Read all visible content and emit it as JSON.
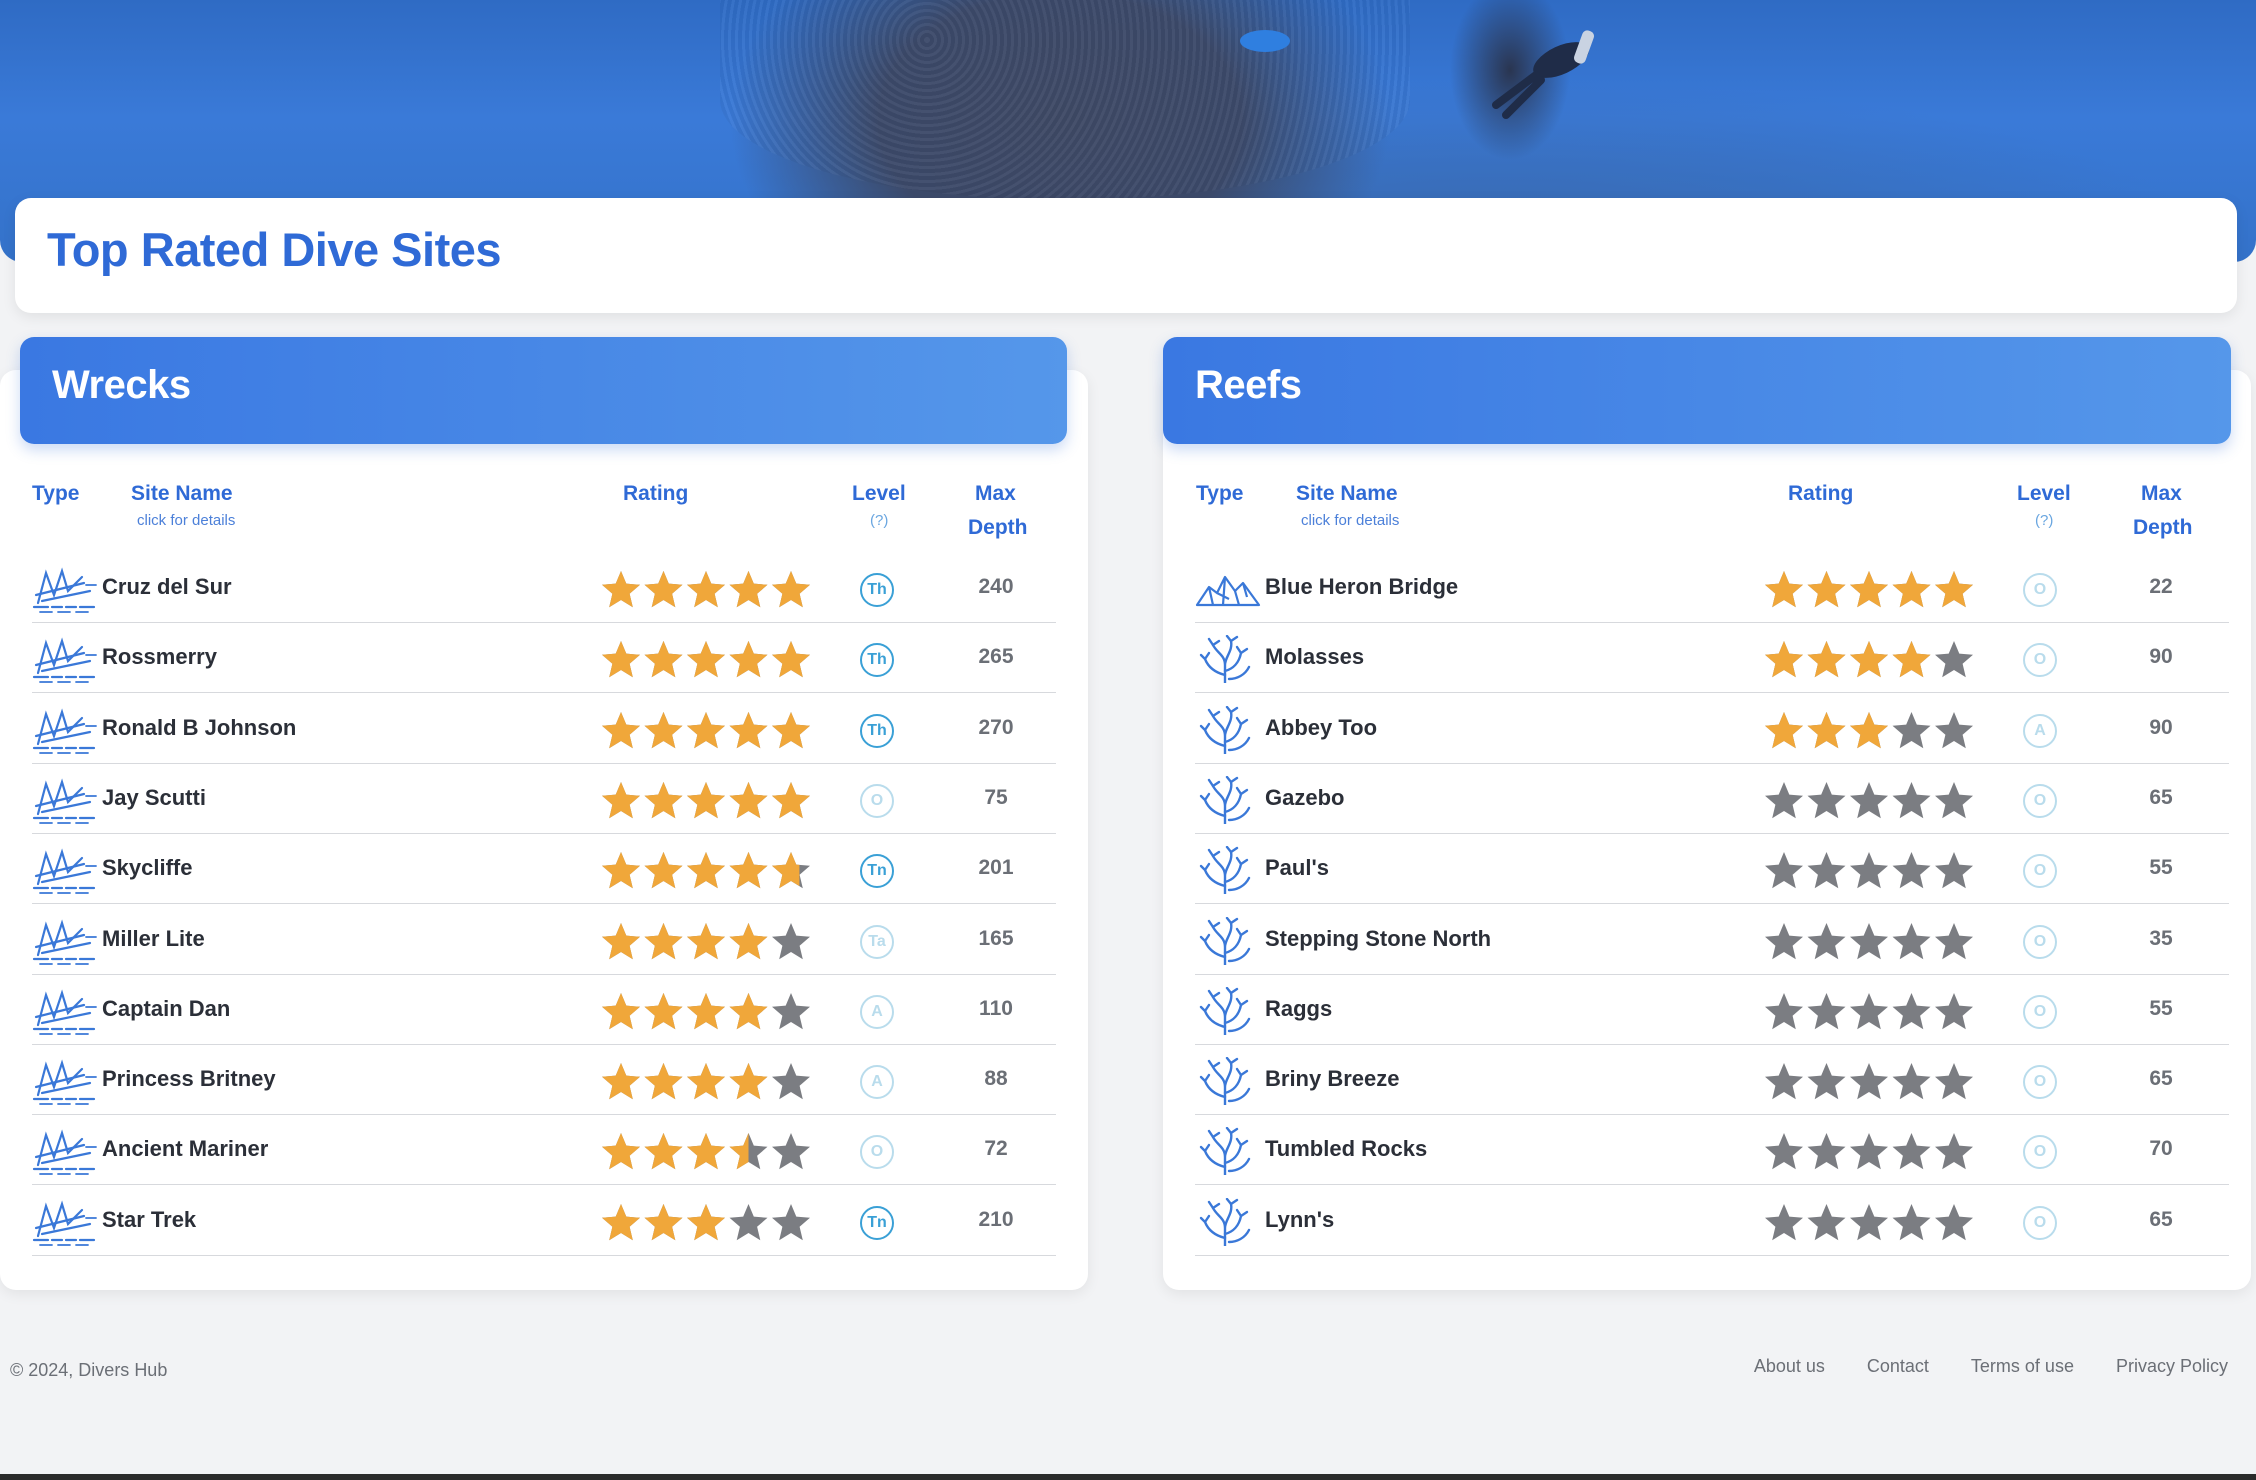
{
  "page": {
    "title": "Top Rated Dive Sites"
  },
  "colors": {
    "accent": "#2f6ad6",
    "star_on": "#f0a73a",
    "star_off": "#7b7d82",
    "level_strong": "#3aa0d6",
    "level_faint": "#b9dcec"
  },
  "columns": {
    "type": "Type",
    "site_name": "Site Name",
    "site_name_hint": "click for details",
    "rating": "Rating",
    "level": "Level",
    "level_hint": "(?)",
    "max": "Max",
    "depth": "Depth"
  },
  "wrecks": {
    "title": "Wrecks",
    "rows": [
      {
        "name": "Cruz del Sur",
        "icon": "wreck-icon",
        "rating": 5,
        "level": "Th",
        "level_active": true,
        "depth": "240"
      },
      {
        "name": "Rossmerry",
        "icon": "wreck-icon",
        "rating": 5,
        "level": "Th",
        "level_active": true,
        "depth": "265"
      },
      {
        "name": "Ronald B Johnson",
        "icon": "wreck-icon",
        "rating": 5,
        "level": "Th",
        "level_active": true,
        "depth": "270"
      },
      {
        "name": "Jay Scutti",
        "icon": "wreck-icon",
        "rating": 5,
        "level": "O",
        "level_active": false,
        "depth": "75"
      },
      {
        "name": "Skycliffe",
        "icon": "wreck-icon",
        "rating": 4.7,
        "level": "Tn",
        "level_active": true,
        "depth": "201"
      },
      {
        "name": "Miller Lite",
        "icon": "wreck-icon",
        "rating": 4,
        "level": "Ta",
        "level_active": false,
        "depth": "165"
      },
      {
        "name": "Captain Dan",
        "icon": "wreck-icon",
        "rating": 4,
        "level": "A",
        "level_active": false,
        "depth": "110"
      },
      {
        "name": "Princess Britney",
        "icon": "wreck-icon",
        "rating": 4,
        "level": "A",
        "level_active": false,
        "depth": "88"
      },
      {
        "name": "Ancient Mariner",
        "icon": "wreck-icon",
        "rating": 3.5,
        "level": "O",
        "level_active": false,
        "depth": "72"
      },
      {
        "name": "Star Trek",
        "icon": "wreck-icon",
        "rating": 3,
        "level": "Tn",
        "level_active": true,
        "depth": "210"
      }
    ]
  },
  "reefs": {
    "title": "Reefs",
    "rows": [
      {
        "name": "Blue Heron Bridge",
        "icon": "rock-reef-icon",
        "rating": 5,
        "level": "O",
        "level_active": false,
        "depth": "22"
      },
      {
        "name": "Molasses",
        "icon": "coral-icon",
        "rating": 4,
        "level": "O",
        "level_active": false,
        "depth": "90"
      },
      {
        "name": "Abbey Too",
        "icon": "coral-icon",
        "rating": 3,
        "level": "A",
        "level_active": false,
        "depth": "90"
      },
      {
        "name": "Gazebo",
        "icon": "coral-icon",
        "rating": 0,
        "level": "O",
        "level_active": false,
        "depth": "65"
      },
      {
        "name": "Paul's",
        "icon": "coral-icon",
        "rating": 0,
        "level": "O",
        "level_active": false,
        "depth": "55"
      },
      {
        "name": "Stepping Stone North",
        "icon": "coral-icon",
        "rating": 0,
        "level": "O",
        "level_active": false,
        "depth": "35"
      },
      {
        "name": "Raggs",
        "icon": "coral-icon",
        "rating": 0,
        "level": "O",
        "level_active": false,
        "depth": "55"
      },
      {
        "name": "Briny Breeze",
        "icon": "coral-icon",
        "rating": 0,
        "level": "O",
        "level_active": false,
        "depth": "65"
      },
      {
        "name": "Tumbled Rocks",
        "icon": "coral-icon",
        "rating": 0,
        "level": "O",
        "level_active": false,
        "depth": "70"
      },
      {
        "name": "Lynn's",
        "icon": "coral-icon",
        "rating": 0,
        "level": "O",
        "level_active": false,
        "depth": "65"
      }
    ]
  },
  "footer": {
    "copyright": "© 2024, Divers Hub",
    "links": [
      "About us",
      "Contact",
      "Terms of use",
      "Privacy Policy"
    ]
  }
}
